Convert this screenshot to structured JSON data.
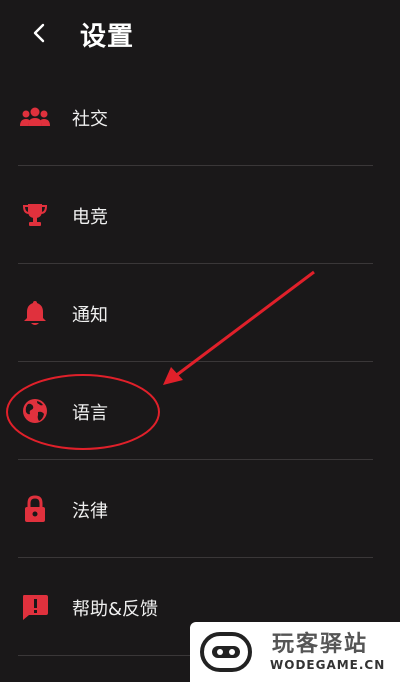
{
  "header": {
    "title": "设置"
  },
  "menu": {
    "items": [
      {
        "label": "社交",
        "icon": "people-group-icon"
      },
      {
        "label": "电竞",
        "icon": "trophy-icon"
      },
      {
        "label": "通知",
        "icon": "bell-icon"
      },
      {
        "label": "语言",
        "icon": "globe-icon"
      },
      {
        "label": "法律",
        "icon": "lock-icon"
      },
      {
        "label": "帮助&反馈",
        "icon": "feedback-icon"
      }
    ]
  },
  "watermark": {
    "cn": "玩客驿站",
    "en": "WODEGAME.CN"
  },
  "colors": {
    "accent": "#e0313d",
    "background": "#1a1819",
    "annotation": "#e0202a"
  }
}
